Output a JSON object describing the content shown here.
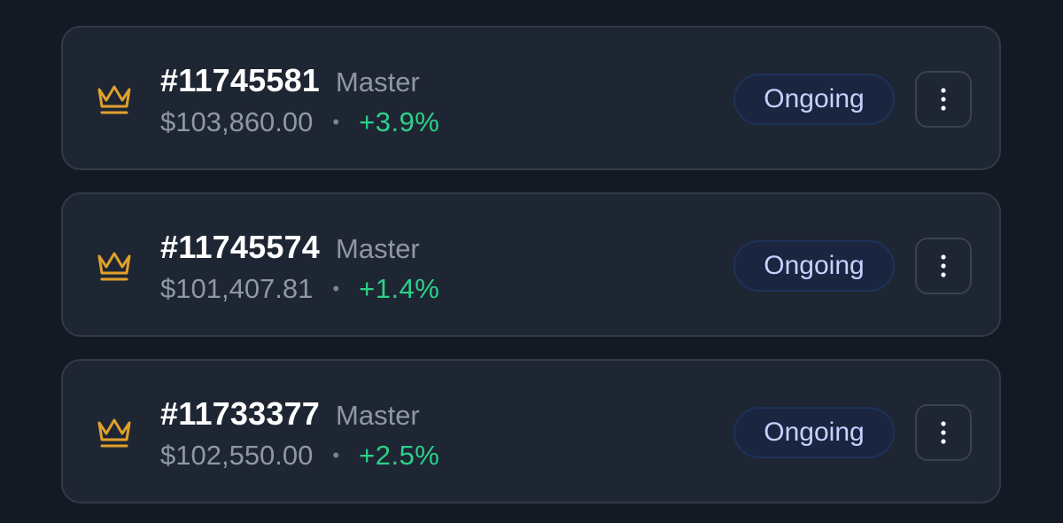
{
  "accounts": [
    {
      "id": "#11745581",
      "tier": "Master",
      "balance": "$103,860.00",
      "separator": "•",
      "change": "+3.9%",
      "status": "Ongoing",
      "icon": "crown-icon",
      "menu_icon": "more-vertical-icon"
    },
    {
      "id": "#11745574",
      "tier": "Master",
      "balance": "$101,407.81",
      "separator": "•",
      "change": "+1.4%",
      "status": "Ongoing",
      "icon": "crown-icon",
      "menu_icon": "more-vertical-icon"
    },
    {
      "id": "#11733377",
      "tier": "Master",
      "balance": "$102,550.00",
      "separator": "•",
      "change": "+2.5%",
      "status": "Ongoing",
      "icon": "crown-icon",
      "menu_icon": "more-vertical-icon"
    }
  ],
  "colors": {
    "background": "#141923",
    "card": "#1f2633",
    "crown": "#e0a12b",
    "positive_change": "#2bd18a",
    "status_text": "#c5d2ff"
  }
}
